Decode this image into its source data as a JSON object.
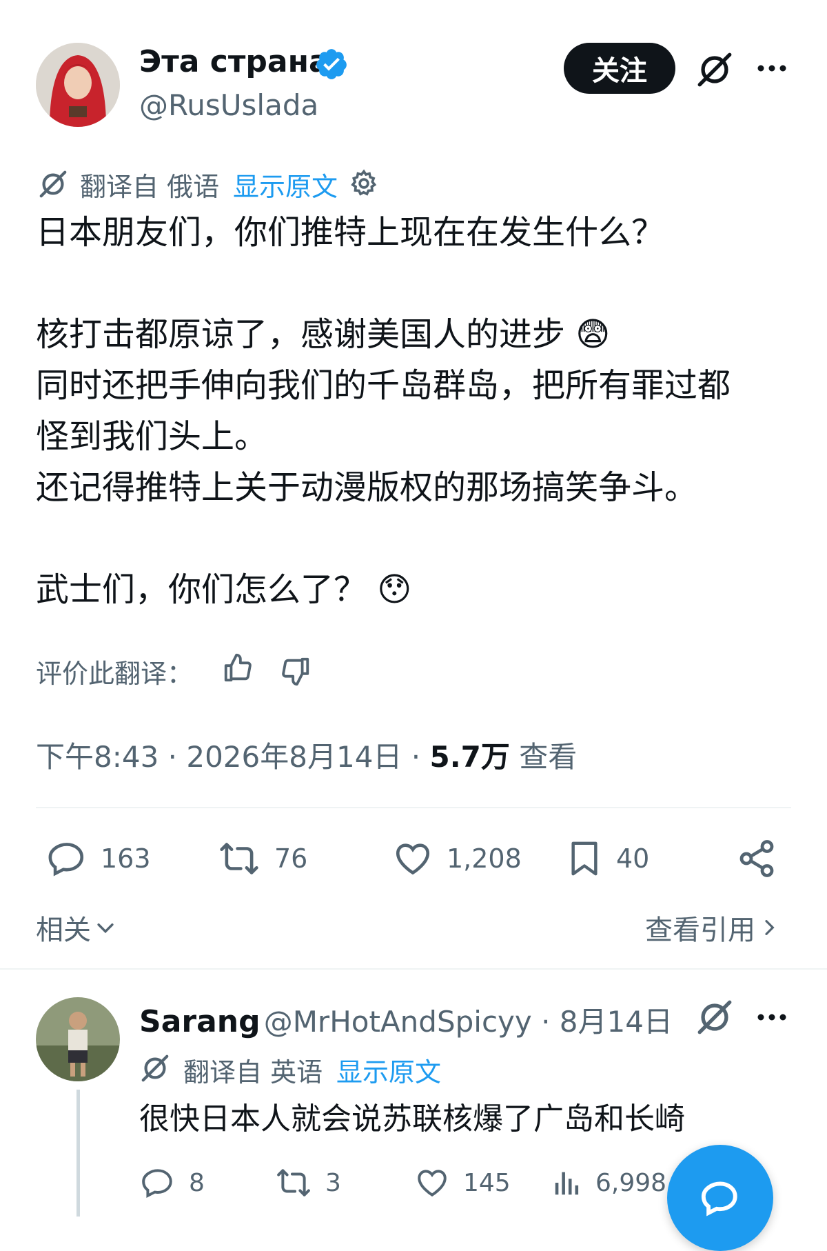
{
  "tweet": {
    "author_name": "Эта страна",
    "author_handle": "@RusUslada",
    "follow_label": "关注",
    "translated_from": "翻译自 俄语",
    "show_original": "显示原文",
    "body_lines": "日本朋友们，你们推特上现在在发生什么？\n\n核打击都原谅了，感谢美国人的进步 😨\n同时还把手伸向我们的千岛群岛，把所有罪过都\n怪到我们头上。\n还记得推特上关于动漫版权的那场搞笑争斗。\n\n武士们，你们怎么了？ 😯",
    "rate_translation": "评价此翻译：",
    "timestamp": "下午8:43 · 2026年8月14日 · ",
    "views_count": "5.7万",
    "views_label": " 查看",
    "stats": {
      "replies": "163",
      "retweets": "76",
      "likes": "1,208",
      "bookmarks": "40"
    },
    "related_label": "相关",
    "view_quotes_label": "查看引用"
  },
  "reply": {
    "author_name": "Sarang",
    "author_handle": "@MrHotAndSpicyy",
    "date": " · 8月14日",
    "translated_from": "翻译自 英语",
    "show_original": "显示原文",
    "body": "很快日本人就会说苏联核爆了广岛和长崎",
    "stats": {
      "replies": "8",
      "retweets": "3",
      "likes": "145",
      "views": "6,998"
    }
  },
  "colors": {
    "text": "#0f1419",
    "secondary": "#536471",
    "accent": "#1d9bf0",
    "verified": "#1d9bf0"
  }
}
